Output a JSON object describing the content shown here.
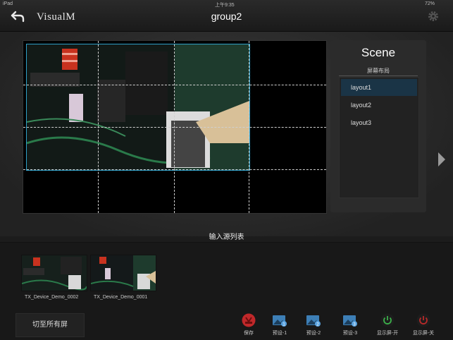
{
  "status": {
    "device": "iPad",
    "time": "上午9:35",
    "battery": "72%"
  },
  "nav": {
    "brand": "VisualM",
    "title": "group2"
  },
  "scene": {
    "title": "Scene",
    "subtitle": "屏幕布局",
    "layouts": [
      "layout1",
      "layout2",
      "layout3"
    ],
    "selected_index": 0
  },
  "inputs": {
    "section_label": "输入源列表",
    "items": [
      {
        "name": "TX_Device_Demo_0002"
      },
      {
        "name": "TX_Device_Demo_0001"
      }
    ]
  },
  "toolbar": {
    "switch_all": "切至所有屏",
    "save": "保存",
    "preset1": "预设-1",
    "preset2": "预设-2",
    "preset3": "预设-3",
    "display_on": "显示屏-开",
    "display_off": "显示屏-关"
  },
  "colors": {
    "accent": "#2ea0c8",
    "save_red": "#c0282a",
    "power_green": "#3cb04a",
    "power_red": "#b82a2a",
    "preset_blue": "#3d7fb6"
  }
}
